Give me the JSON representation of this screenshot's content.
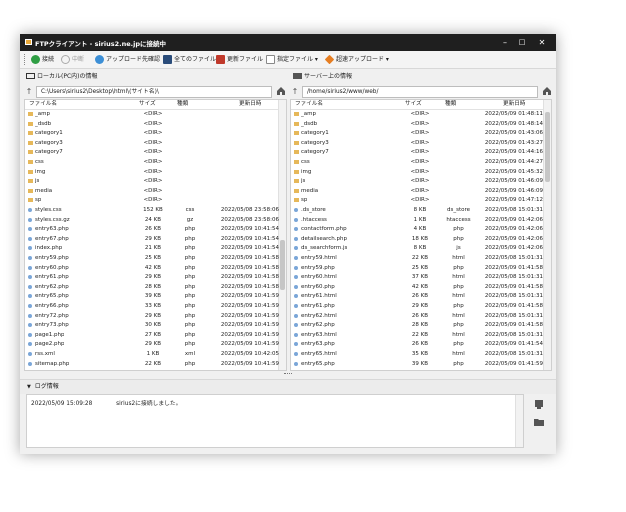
{
  "window": {
    "title": "FTPクライアント - sirius2.ne.jpに接続中"
  },
  "toolbar": {
    "connect": "接続",
    "stop": "中断",
    "upload_confirm": "アップロード先確認",
    "all_files": "全てのファイル",
    "updated_files": "更新ファイル",
    "specified_files": "指定ファイル",
    "turbo_upload": "超速アップロード"
  },
  "left": {
    "title": "ローカル(PC内)の情報",
    "path": "C:\\Users\\sirius2\\Desktop\\html\\(サイト名)\\",
    "columns": {
      "name": "ファイル名",
      "size": "サイズ",
      "type": "種類",
      "date": "更新日時"
    },
    "rows": [
      {
        "n": "_amp",
        "s": "<DIR>",
        "t": "",
        "d": "",
        "dir": true
      },
      {
        "n": "_dsdb",
        "s": "<DIR>",
        "t": "",
        "d": "",
        "dir": true
      },
      {
        "n": "category1",
        "s": "<DIR>",
        "t": "",
        "d": "",
        "dir": true
      },
      {
        "n": "category3",
        "s": "<DIR>",
        "t": "",
        "d": "",
        "dir": true
      },
      {
        "n": "category7",
        "s": "<DIR>",
        "t": "",
        "d": "",
        "dir": true
      },
      {
        "n": "css",
        "s": "<DIR>",
        "t": "",
        "d": "",
        "dir": true
      },
      {
        "n": "img",
        "s": "<DIR>",
        "t": "",
        "d": "",
        "dir": true
      },
      {
        "n": "js",
        "s": "<DIR>",
        "t": "",
        "d": "",
        "dir": true
      },
      {
        "n": "media",
        "s": "<DIR>",
        "t": "",
        "d": "",
        "dir": true
      },
      {
        "n": "sp",
        "s": "<DIR>",
        "t": "",
        "d": "",
        "dir": true
      },
      {
        "n": "styles.css",
        "s": "152 KB",
        "t": "css",
        "d": "2022/05/08 23:58:06",
        "dir": false
      },
      {
        "n": "styles.css.gz",
        "s": "24 KB",
        "t": "gz",
        "d": "2022/05/08 23:58:06",
        "dir": false
      },
      {
        "n": "entry63.php",
        "s": "26 KB",
        "t": "php",
        "d": "2022/05/09 10:41:54",
        "dir": false
      },
      {
        "n": "entry67.php",
        "s": "29 KB",
        "t": "php",
        "d": "2022/05/09 10:41:54",
        "dir": false
      },
      {
        "n": "index.php",
        "s": "21 KB",
        "t": "php",
        "d": "2022/05/09 10:41:54",
        "dir": false
      },
      {
        "n": "entry59.php",
        "s": "25 KB",
        "t": "php",
        "d": "2022/05/09 10:41:58",
        "dir": false
      },
      {
        "n": "entry60.php",
        "s": "42 KB",
        "t": "php",
        "d": "2022/05/09 10:41:58",
        "dir": false
      },
      {
        "n": "entry61.php",
        "s": "29 KB",
        "t": "php",
        "d": "2022/05/09 10:41:58",
        "dir": false
      },
      {
        "n": "entry62.php",
        "s": "28 KB",
        "t": "php",
        "d": "2022/05/09 10:41:58",
        "dir": false
      },
      {
        "n": "entry65.php",
        "s": "39 KB",
        "t": "php",
        "d": "2022/05/09 10:41:59",
        "dir": false
      },
      {
        "n": "entry66.php",
        "s": "33 KB",
        "t": "php",
        "d": "2022/05/09 10:41:59",
        "dir": false
      },
      {
        "n": "entry72.php",
        "s": "29 KB",
        "t": "php",
        "d": "2022/05/09 10:41:59",
        "dir": false
      },
      {
        "n": "entry73.php",
        "s": "30 KB",
        "t": "php",
        "d": "2022/05/09 10:41:59",
        "dir": false
      },
      {
        "n": "page1.php",
        "s": "27 KB",
        "t": "php",
        "d": "2022/05/09 10:41:59",
        "dir": false
      },
      {
        "n": "page2.php",
        "s": "29 KB",
        "t": "php",
        "d": "2022/05/09 10:41:59",
        "dir": false
      },
      {
        "n": "rss.xml",
        "s": "1 KB",
        "t": "xml",
        "d": "2022/05/09 10:42:05",
        "dir": false
      },
      {
        "n": "sitemap.php",
        "s": "22 KB",
        "t": "php",
        "d": "2022/05/09 10:41:59",
        "dir": false
      }
    ]
  },
  "right": {
    "title": "サーバー上の情報",
    "path": "/home/sirius2/www/web/",
    "columns": {
      "name": "ファイル名",
      "size": "サイズ",
      "type": "種類",
      "date": "更新日時"
    },
    "rows": [
      {
        "n": "_amp",
        "s": "<DIR>",
        "t": "",
        "d": "2022/05/09 01:48:11",
        "dir": true
      },
      {
        "n": "_dsdb",
        "s": "<DIR>",
        "t": "",
        "d": "2022/05/09 01:48:14",
        "dir": true
      },
      {
        "n": "category1",
        "s": "<DIR>",
        "t": "",
        "d": "2022/05/09 01:43:06",
        "dir": true
      },
      {
        "n": "category3",
        "s": "<DIR>",
        "t": "",
        "d": "2022/05/09 01:43:27",
        "dir": true
      },
      {
        "n": "category7",
        "s": "<DIR>",
        "t": "",
        "d": "2022/05/09 01:44:16",
        "dir": true
      },
      {
        "n": "css",
        "s": "<DIR>",
        "t": "",
        "d": "2022/05/09 01:44:27",
        "dir": true
      },
      {
        "n": "img",
        "s": "<DIR>",
        "t": "",
        "d": "2022/05/09 01:45:32",
        "dir": true
      },
      {
        "n": "js",
        "s": "<DIR>",
        "t": "",
        "d": "2022/05/09 01:46:09",
        "dir": true
      },
      {
        "n": "media",
        "s": "<DIR>",
        "t": "",
        "d": "2022/05/09 01:46:09",
        "dir": true
      },
      {
        "n": "sp",
        "s": "<DIR>",
        "t": "",
        "d": "2022/05/09 01:47:12",
        "dir": true
      },
      {
        "n": ".ds_store",
        "s": "8 KB",
        "t": "ds_store",
        "d": "2022/05/08 15:01:31",
        "dir": false
      },
      {
        "n": ".htaccess",
        "s": "1 KB",
        "t": "htaccess",
        "d": "2022/05/09 01:42:06",
        "dir": false
      },
      {
        "n": "contactform.php",
        "s": "4 KB",
        "t": "php",
        "d": "2022/05/09 01:42:06",
        "dir": false
      },
      {
        "n": "detailsearch.php",
        "s": "18 KB",
        "t": "php",
        "d": "2022/05/09 01:42:06",
        "dir": false
      },
      {
        "n": "ds_searchform.js",
        "s": "8 KB",
        "t": "js",
        "d": "2022/05/09 01:42:06",
        "dir": false
      },
      {
        "n": "entry59.html",
        "s": "22 KB",
        "t": "html",
        "d": "2022/05/08 15:01:31",
        "dir": false
      },
      {
        "n": "entry59.php",
        "s": "25 KB",
        "t": "php",
        "d": "2022/05/09 01:41:58",
        "dir": false
      },
      {
        "n": "entry60.html",
        "s": "37 KB",
        "t": "html",
        "d": "2022/05/08 15:01:31",
        "dir": false
      },
      {
        "n": "entry60.php",
        "s": "42 KB",
        "t": "php",
        "d": "2022/05/09 01:41:58",
        "dir": false
      },
      {
        "n": "entry61.html",
        "s": "26 KB",
        "t": "html",
        "d": "2022/05/08 15:01:31",
        "dir": false
      },
      {
        "n": "entry61.php",
        "s": "29 KB",
        "t": "php",
        "d": "2022/05/09 01:41:58",
        "dir": false
      },
      {
        "n": "entry62.html",
        "s": "26 KB",
        "t": "html",
        "d": "2022/05/08 15:01:31",
        "dir": false
      },
      {
        "n": "entry62.php",
        "s": "28 KB",
        "t": "php",
        "d": "2022/05/09 01:41:58",
        "dir": false
      },
      {
        "n": "entry63.html",
        "s": "22 KB",
        "t": "html",
        "d": "2022/05/08 15:01:31",
        "dir": false
      },
      {
        "n": "entry63.php",
        "s": "26 KB",
        "t": "php",
        "d": "2022/05/09 01:41:54",
        "dir": false
      },
      {
        "n": "entry65.html",
        "s": "35 KB",
        "t": "html",
        "d": "2022/05/08 15:01:31",
        "dir": false
      },
      {
        "n": "entry65.php",
        "s": "39 KB",
        "t": "php",
        "d": "2022/05/09 01:41:59",
        "dir": false
      }
    ]
  },
  "log": {
    "title": "ログ情報",
    "entries": [
      {
        "time": "2022/05/09 15:09:28",
        "msg": "sirius2に接続しました。"
      }
    ]
  }
}
